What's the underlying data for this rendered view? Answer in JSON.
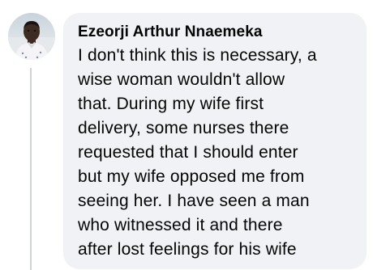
{
  "comment": {
    "author_name": "Ezeorji Arthur Nnaemeka",
    "text_lines": [
      "I don't think this is necessary, a",
      "wise woman wouldn't allow",
      "that. During my wife first",
      "delivery, some nurses there",
      "requested that I should enter",
      "but my wife opposed me from",
      "seeing her. I have seen a man",
      "who witnessed it  and there",
      "after lost feelings for his wife"
    ],
    "avatar_icon": "user-profile-photo"
  },
  "colors": {
    "bubble_background": "#f0f2f5",
    "text": "#050505",
    "thread_line": "#d0d3d8"
  }
}
